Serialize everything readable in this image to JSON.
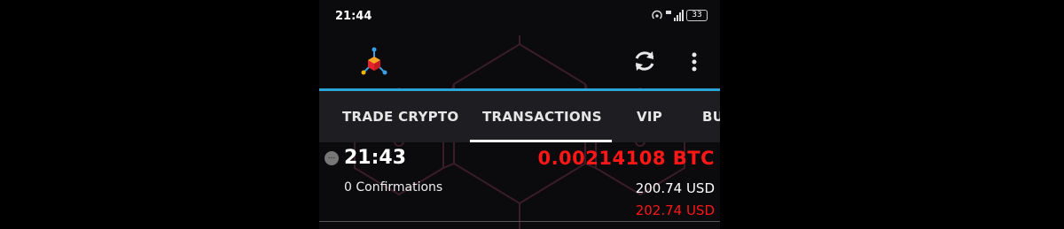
{
  "status_bar": {
    "time": "21:44",
    "battery": "33"
  },
  "tabs": [
    {
      "label": "TRADE CRYPTO"
    },
    {
      "label": "TRANSACTIONS"
    },
    {
      "label": "VIP"
    },
    {
      "label": "BU"
    }
  ],
  "active_tab": "TRANSACTIONS",
  "transaction": {
    "time": "21:43",
    "amount": "0.00214108 BTC",
    "confirmations": "0 Confirmations",
    "usd_value": "200.74 USD",
    "usd_value_alt": "202.74 USD",
    "status_dot": "..."
  },
  "colors": {
    "accent": "#2aa6d6",
    "amount": "#ff1616",
    "tab_bar": "#1e1e22"
  }
}
